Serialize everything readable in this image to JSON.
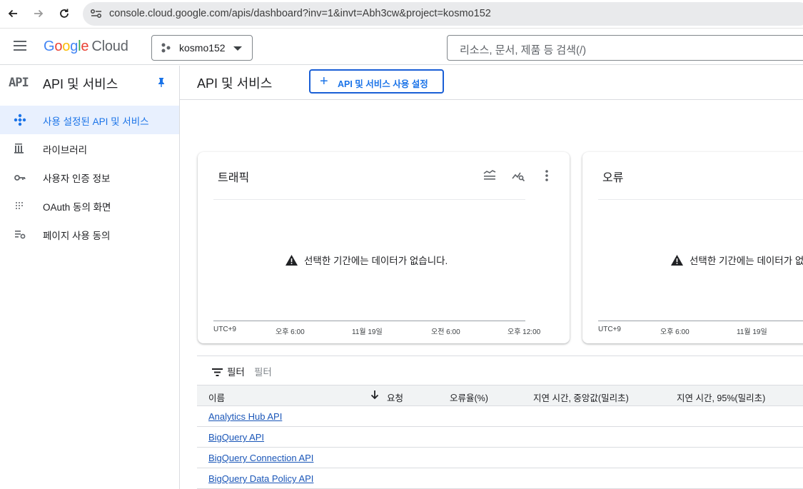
{
  "browser": {
    "url": "console.cloud.google.com/apis/dashboard?inv=1&invt=Abh3cw&project=kosmo152"
  },
  "header": {
    "logo_google": "Google",
    "logo_cloud": "Cloud",
    "project_name": "kosmo152",
    "search_placeholder": "리소스, 문서, 제품 등 검색(/)"
  },
  "sidebar": {
    "mark": "API",
    "title": "API 및 서비스",
    "items": [
      {
        "label": "사용 설정된 API 및 서비스",
        "icon": "api-diamond-icon",
        "active": true
      },
      {
        "label": "라이브러리",
        "icon": "library-icon",
        "active": false
      },
      {
        "label": "사용자 인증 정보",
        "icon": "key-icon",
        "active": false
      },
      {
        "label": "OAuth 동의 화면",
        "icon": "oauth-dots-icon",
        "active": false
      },
      {
        "label": "페이지 사용 동의",
        "icon": "settings-list-icon",
        "active": false
      }
    ]
  },
  "main": {
    "title": "API 및 서비스",
    "enable_button": "API 및 서비스 사용 설정"
  },
  "cards": [
    {
      "title": "트래픽",
      "no_data": "선택한 기간에는 데이터가 없습니다.",
      "axis": [
        "UTC+9",
        "오후 6:00",
        "11월 19일",
        "오전 6:00",
        "오후 12:00"
      ]
    },
    {
      "title": "오류",
      "no_data": "선택한 기간에는 데이터가 없습니다.",
      "axis": [
        "UTC+9",
        "오후 6:00",
        "11월 19일"
      ]
    }
  ],
  "filter": {
    "label": "필터",
    "placeholder": "필터"
  },
  "table": {
    "columns": [
      "이름",
      "요청",
      "오류율(%)",
      "지연 시간, 중앙값(밀리초)",
      "지연 시간, 95%(밀리초)"
    ],
    "rows": [
      "Analytics Hub API",
      "BigQuery API",
      "BigQuery Connection API",
      "BigQuery Data Policy API"
    ]
  },
  "colors": {
    "accent": "#1a73e8",
    "active_bg": "#e8f0fe"
  }
}
